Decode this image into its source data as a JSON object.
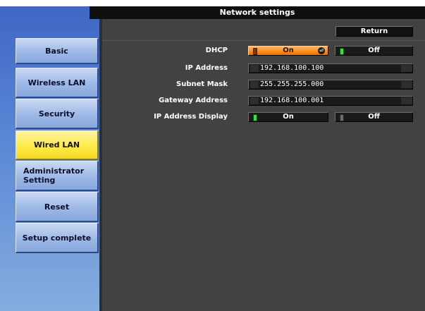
{
  "window": {
    "title": "Network settings"
  },
  "sidebar": {
    "items": [
      {
        "label": "Basic"
      },
      {
        "label": "Wireless LAN"
      },
      {
        "label": "Security"
      },
      {
        "label": "Wired LAN",
        "active": true
      },
      {
        "label": "Administrator Setting"
      },
      {
        "label": "Reset"
      },
      {
        "label": "Setup complete"
      }
    ]
  },
  "toolbar": {
    "return_label": "Return"
  },
  "form": {
    "dhcp": {
      "label": "DHCP",
      "on_label": "On",
      "off_label": "Off",
      "selected": "On"
    },
    "ip_address": {
      "label": "IP Address",
      "value": "192.168.100.100"
    },
    "subnet_mask": {
      "label": "Subnet Mask",
      "value": "255.255.255.000"
    },
    "gateway_address": {
      "label": "Gateway Address",
      "value": "192.168.100.001"
    },
    "ip_address_display": {
      "label": "IP Address Display",
      "on_label": "On",
      "off_label": "Off",
      "selected": "On"
    }
  },
  "colors": {
    "sidebar_gradient_top": "#3f67c4",
    "nav_item": "#9db9e6",
    "nav_active": "#ffea4a",
    "focus_orange": "#ff8c1a",
    "led_green": "#33e23a",
    "panel_bg": "#424242",
    "titlebar": "#0f0f0f"
  },
  "icons": {
    "enter": "enter-return-icon",
    "led": "indicator-led-icon"
  }
}
